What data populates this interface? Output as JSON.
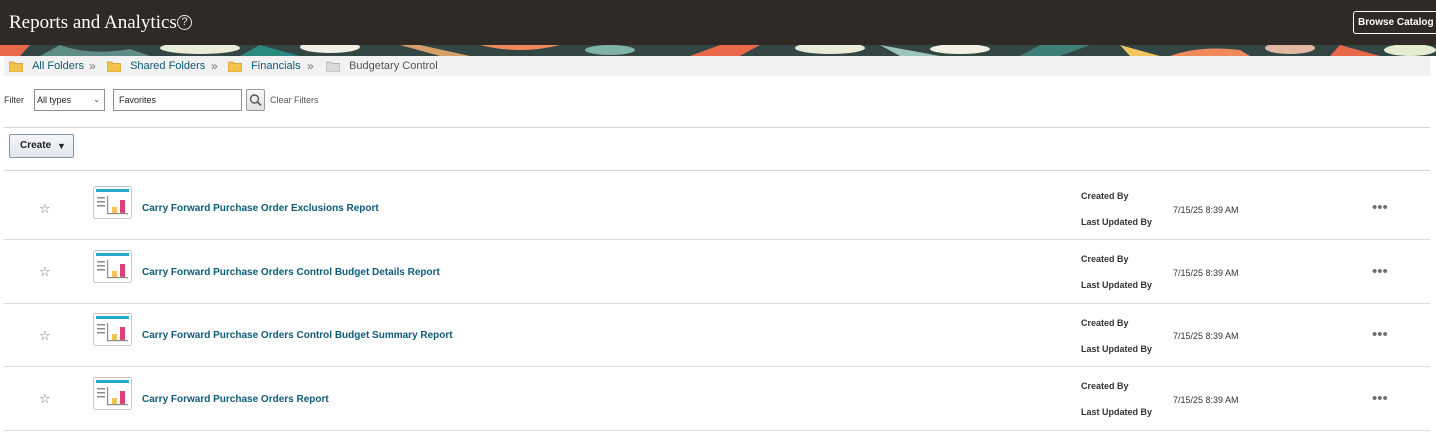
{
  "header": {
    "title": "Reports and Analytics",
    "help_glyph": "?",
    "browse_label": "Browse Catalog"
  },
  "breadcrumb": {
    "items": [
      "All Folders",
      "Shared Folders",
      "Financials"
    ],
    "current": "Budgetary Control",
    "separator": "»"
  },
  "filter": {
    "label": "Filter",
    "type_value": "All types",
    "search_value": "Favorites",
    "clear_label": "Clear Filters"
  },
  "toolbar": {
    "create_label": "Create"
  },
  "meta_labels": {
    "created_by": "Created By",
    "last_updated_by": "Last Updated By"
  },
  "reports": [
    {
      "name": "Carry Forward Purchase Order Exclusions Report",
      "updated": "7/15/25 8:39 AM"
    },
    {
      "name": "Carry Forward Purchase Orders Control Budget Details Report",
      "updated": "7/15/25 8:39 AM"
    },
    {
      "name": "Carry Forward Purchase Orders Control Budget Summary Report",
      "updated": "7/15/25 8:39 AM"
    },
    {
      "name": "Carry Forward Purchase Orders Report",
      "updated": "7/15/25 8:39 AM"
    }
  ],
  "glyphs": {
    "star": "☆",
    "more": "•••",
    "caret": "▼"
  },
  "colors": {
    "topbar": "#2f2a26",
    "link": "#0e5a7a",
    "icon_accent": "#2aa8cc"
  }
}
